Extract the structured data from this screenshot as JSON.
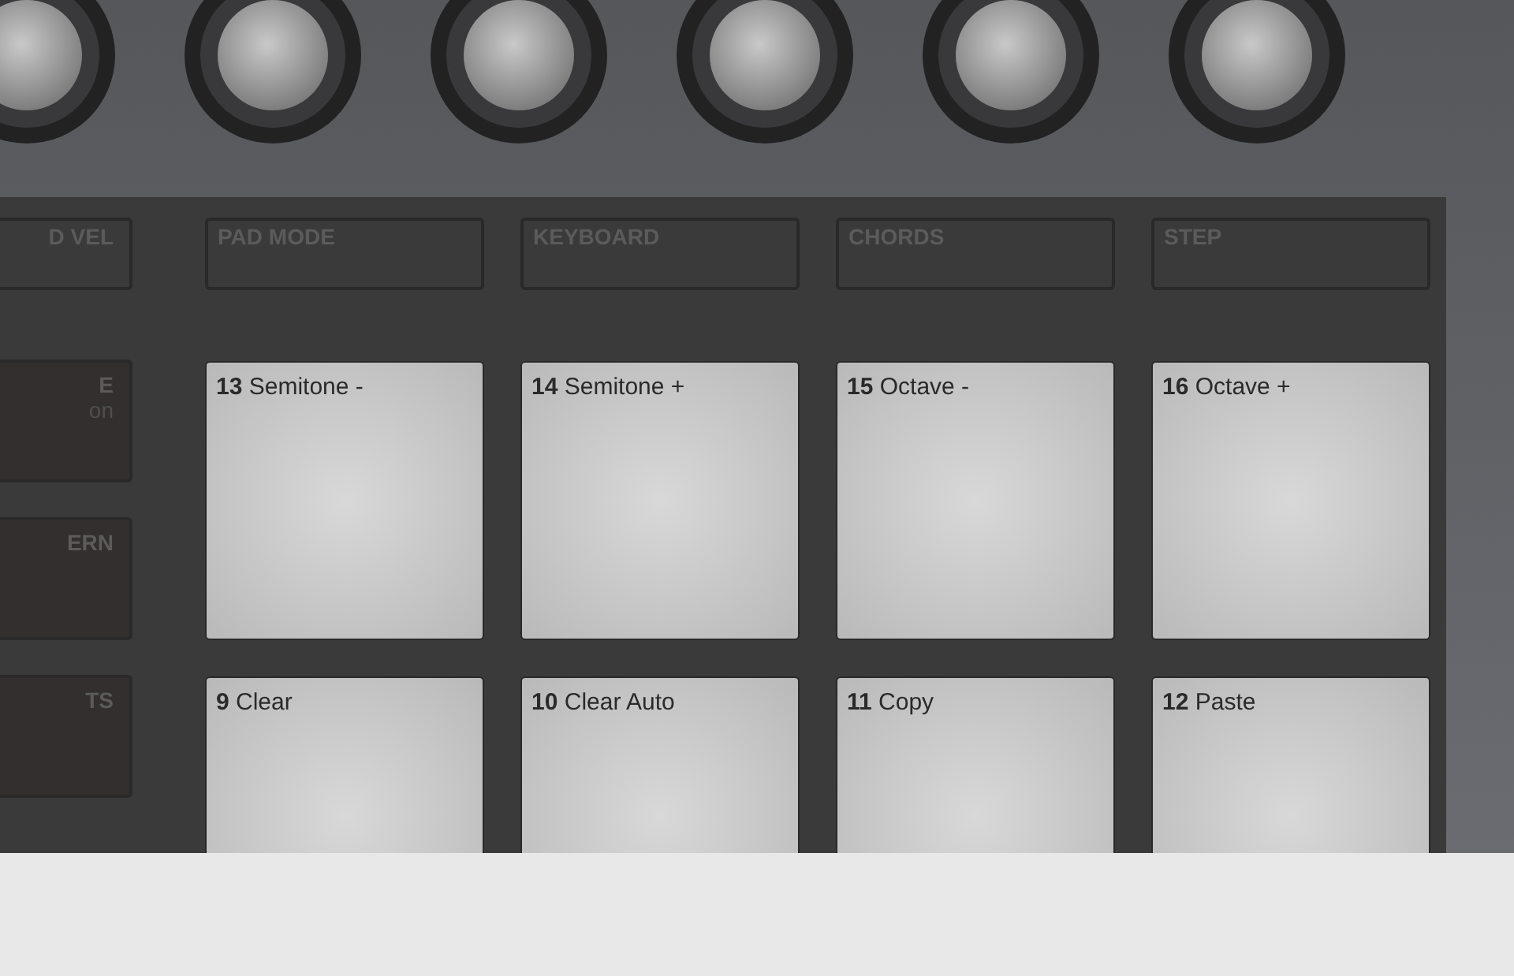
{
  "side_buttons": [
    {
      "label": "D VEL"
    },
    {
      "label": "E",
      "sublabel": "on"
    },
    {
      "label": "ERN"
    },
    {
      "label": "TS"
    }
  ],
  "mode_buttons": [
    {
      "label": "PAD MODE"
    },
    {
      "label": "KEYBOARD"
    },
    {
      "label": "CHORDS"
    },
    {
      "label": "STEP"
    }
  ],
  "pads": [
    {
      "number": "13",
      "label": "Semitone -"
    },
    {
      "number": "14",
      "label": "Semitone +"
    },
    {
      "number": "15",
      "label": "Octave -"
    },
    {
      "number": "16",
      "label": "Octave +"
    },
    {
      "number": "9",
      "label": "Clear"
    },
    {
      "number": "10",
      "label": "Clear Auto"
    },
    {
      "number": "11",
      "label": "Copy"
    },
    {
      "number": "12",
      "label": "Paste"
    }
  ]
}
